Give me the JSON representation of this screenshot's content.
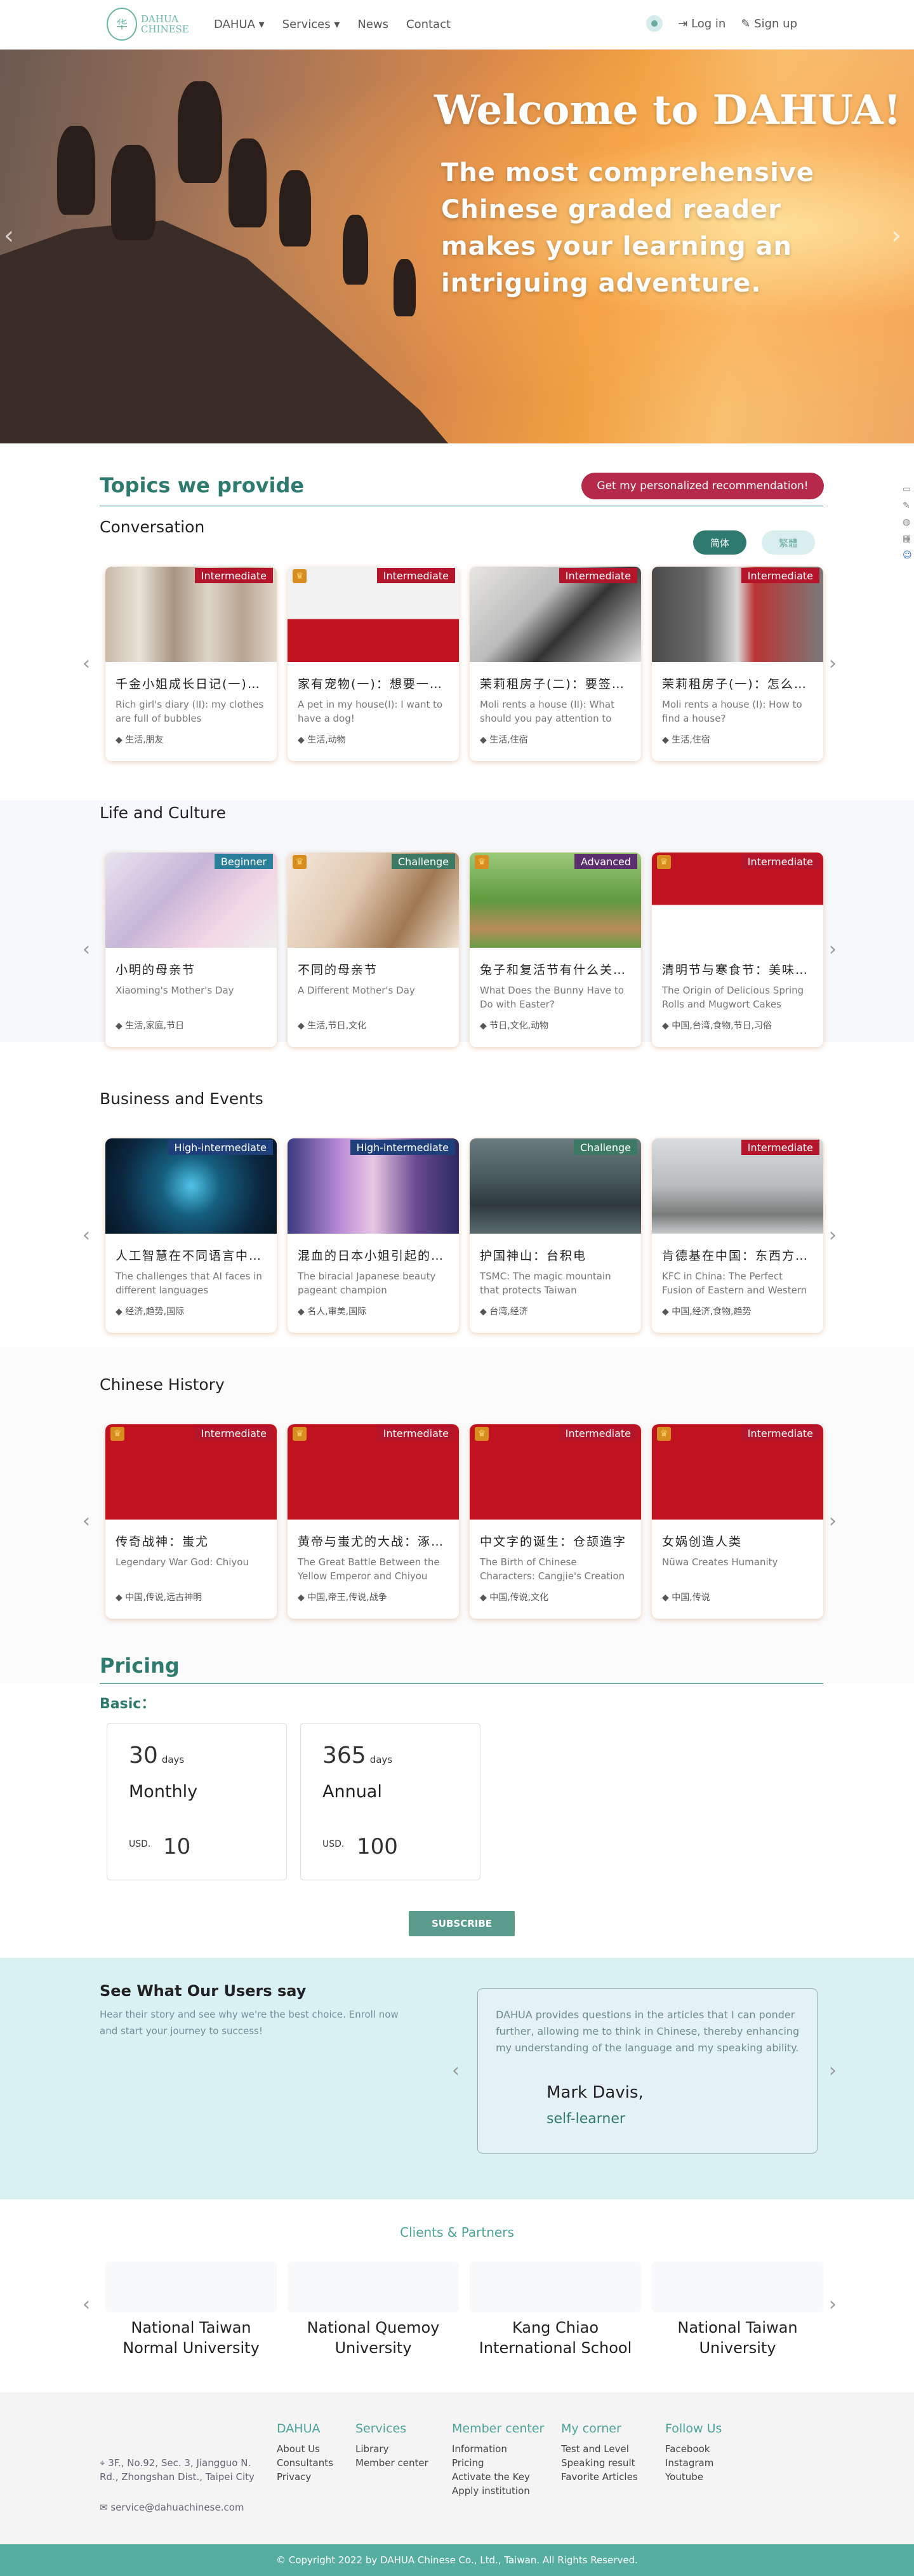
{
  "header": {
    "logo_text_1": "DAHUA",
    "logo_text_2": "CHINESE",
    "logo_mark": "华",
    "nav": [
      "DAHUA",
      "Services",
      "News",
      "Contact"
    ],
    "login": "Log in",
    "signup": "Sign up"
  },
  "hero": {
    "title": "Welcome to DAHUA!",
    "subtitle": "The most comprehensive Chinese graded reader makes your learning an intriguing adventure."
  },
  "topics": {
    "heading": "Topics we provide",
    "reco_button": "Get my personalized recommendation!",
    "toggle_simplified": "简体",
    "toggle_traditional": "繁體",
    "categories": [
      {
        "title": "Conversation",
        "cards": [
          {
            "level": "Intermediate",
            "level_color": "#b5152b",
            "zh": "千金小姐成长日记(一)：我的衣服都是毛球",
            "en": "Rich girl's diary (II): my clothes are full of bubbles",
            "tags": "生活,朋友",
            "crown": false,
            "img": "washer"
          },
          {
            "level": "Intermediate",
            "level_color": "#b5152b",
            "zh": "家有宠物(一)：想要一只狗！",
            "en": "A pet in my house(I): I want to have a dog!",
            "tags": "生活,动物",
            "crown": true,
            "img": "dog"
          },
          {
            "level": "Intermediate",
            "level_color": "#b5152b",
            "zh": "茉莉租房子(二)：要签合约",
            "en": "Moli rents a house (II): What should you pay attention to",
            "tags": "生活,住宿",
            "crown": false,
            "img": "sign"
          },
          {
            "level": "Intermediate",
            "level_color": "#b5152b",
            "zh": "茉莉租房子(一)：怎么找房子？",
            "en": "Moli rents a house (I): How to find a house?",
            "tags": "生活,住宿",
            "crown": false,
            "img": "rent"
          }
        ]
      },
      {
        "title": "Life and Culture",
        "cards": [
          {
            "level": "Beginner",
            "level_color": "#2b7f9a",
            "zh": "小明的母亲节",
            "en": "Xiaoming's Mother's Day",
            "tags": "生活,家庭,节日",
            "crown": false,
            "img": "flowers"
          },
          {
            "level": "Challenge",
            "level_color": "#3c7a66",
            "zh": "不同的母亲节",
            "en": "A Different Mother's Day",
            "tags": "生活,节日,文化",
            "crown": true,
            "img": "mother"
          },
          {
            "level": "Advanced",
            "level_color": "#5b2e6e",
            "zh": "兔子和复活节有什么关系？",
            "en": "What Does the Bunny Have to Do with Easter?",
            "tags": "节日,文化,动物",
            "crown": true,
            "img": "easter"
          },
          {
            "level": "Intermediate",
            "level_color": "#b5152b",
            "zh": "清明节与寒食节：美味的春卷与艾草粿",
            "en": "The Origin of Delicious Spring Rolls and Mugwort Cakes",
            "tags": "中国,台湾,食物,节日,习俗",
            "crown": true,
            "img": "food"
          }
        ]
      },
      {
        "title": "Business and Events",
        "cards": [
          {
            "level": "High-intermediate",
            "level_color": "#1f3f7a",
            "zh": "人工智慧在不同语言中的挑战",
            "en": "The challenges that AI faces in different languages",
            "tags": "经济,趋势,国际",
            "crown": false,
            "img": "ai"
          },
          {
            "level": "High-intermediate",
            "level_color": "#1f3f7a",
            "zh": "混血的日本小姐引起的争议",
            "en": "The biracial Japanese beauty pageant champion",
            "tags": "名人,审美,国际",
            "crown": false,
            "img": "pageant"
          },
          {
            "level": "Challenge",
            "level_color": "#3c7a66",
            "zh": "护国神山：台积电",
            "en": "TSMC: The magic mountain that protects Taiwan",
            "tags": "台湾,经济",
            "crown": false,
            "img": "tsmc"
          },
          {
            "level": "Intermediate",
            "level_color": "#b5152b",
            "zh": "肯德基在中国：东西方的完美融合",
            "en": "KFC in China: The Perfect Fusion of Eastern and Western",
            "tags": "中国,经济,食物,趋势",
            "crown": false,
            "img": "kfc"
          }
        ]
      },
      {
        "title": "Chinese History",
        "cards": [
          {
            "level": "Intermediate",
            "level_color": "#b5152b",
            "zh": "传奇战神：蚩尤",
            "en": "Legendary War God: Chiyou",
            "tags": "中国,传说,远古神明",
            "crown": true,
            "img": "red"
          },
          {
            "level": "Intermediate",
            "level_color": "#b5152b",
            "zh": "黄帝与蚩尤的大战：涿鹿之战",
            "en": "The Great Battle Between the Yellow Emperor and Chiyou",
            "tags": "中国,帝王,传说,战争",
            "crown": true,
            "img": "red"
          },
          {
            "level": "Intermediate",
            "level_color": "#b5152b",
            "zh": "中文字的诞生：仓颉造字",
            "en": "The Birth of Chinese Characters: Cangjie's Creation",
            "tags": "中国,传说,文化",
            "crown": true,
            "img": "red"
          },
          {
            "level": "Intermediate",
            "level_color": "#b5152b",
            "zh": "女娲创造人类",
            "en": "Nüwa Creates Humanity",
            "tags": "中国,传说",
            "crown": true,
            "img": "red"
          }
        ]
      }
    ]
  },
  "pricing": {
    "heading": "Pricing",
    "basic_label": "Basic：",
    "plans": [
      {
        "num": "30",
        "unit": "days",
        "name": "Monthly",
        "currency": "USD.",
        "amount": "10"
      },
      {
        "num": "365",
        "unit": "days",
        "name": "Annual",
        "currency": "USD.",
        "amount": "100"
      }
    ],
    "subscribe": "SUBSCRIBE"
  },
  "testimonials": {
    "heading": "See What Our Users say",
    "subtitle": "Hear their story and see why we're the best choice. Enroll now and start your journey to success!",
    "quote": "DAHUA provides questions in the articles that I can ponder further, allowing me to think in Chinese, thereby enhancing my understanding of the language and my speaking ability.",
    "name": "Mark Davis,",
    "role": "self-learner"
  },
  "partners": {
    "heading": "Clients & Partners",
    "items": [
      "National Taiwan Normal University",
      "National Quemoy University",
      "Kang Chiao International School",
      "National Taiwan University"
    ]
  },
  "footer": {
    "address": "3F., No.92, Sec. 3, Jiangguo N. Rd., Zhongshan Dist., Taipei City",
    "email": "service@dahuachinese.com",
    "columns": [
      {
        "head": "DAHUA",
        "items": [
          "About Us",
          "Consultants",
          "Privacy"
        ]
      },
      {
        "head": "Services",
        "items": [
          "Library",
          "Member center"
        ]
      },
      {
        "head": "Member center",
        "items": [
          "Information",
          "Pricing",
          "Activate the Key",
          "Apply institution"
        ]
      },
      {
        "head": "My corner",
        "items": [
          "Test and Level",
          "Speaking result",
          "Favorite Articles"
        ]
      },
      {
        "head": "Follow Us",
        "items": [
          "Facebook",
          "Instagram",
          "Youtube"
        ]
      }
    ],
    "copyright": "© Copyright 2022 by DAHUA Chinese Co., Ltd., Taiwan. All Rights Reserved."
  }
}
